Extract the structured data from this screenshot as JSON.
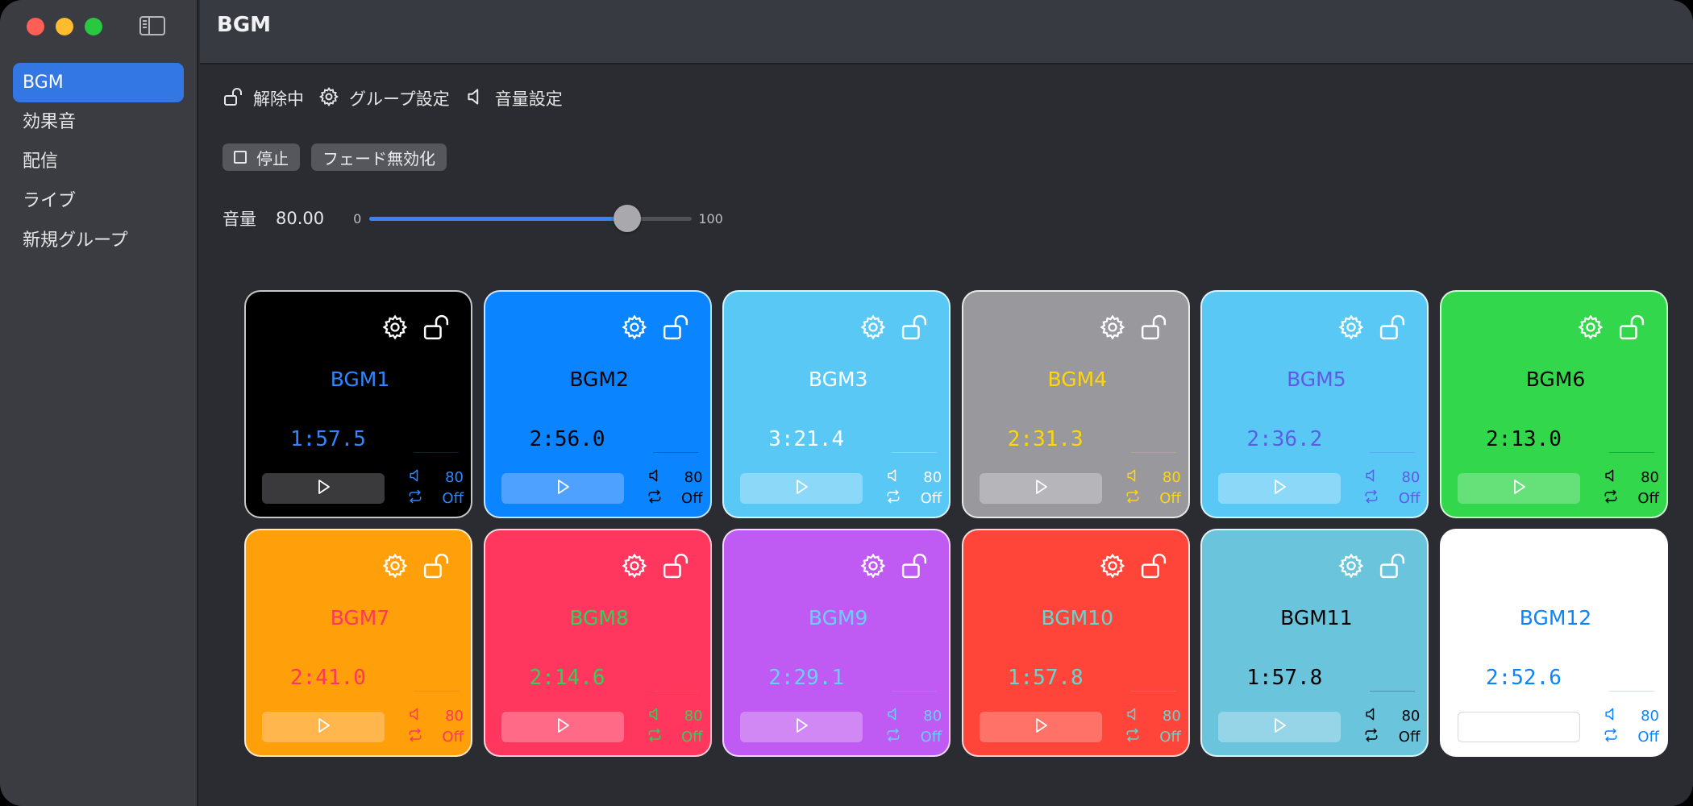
{
  "window": {
    "title": "BGM"
  },
  "sidebar": {
    "items": [
      {
        "label": "BGM",
        "active": true
      },
      {
        "label": "効果音"
      },
      {
        "label": "配信"
      },
      {
        "label": "ライブ"
      },
      {
        "label": "新規グループ"
      }
    ]
  },
  "toolbar": {
    "lock_label": "解除中",
    "group_settings_label": "グループ設定",
    "volume_settings_label": "音量設定"
  },
  "buttons": {
    "stop_label": "停止",
    "fade_label": "フェード無効化"
  },
  "volume": {
    "label": "音量",
    "value": "80.00",
    "min": "0",
    "max": "100",
    "level": 0.8,
    "accent": "#3a82f7"
  },
  "cards": [
    {
      "name": "BGM1",
      "time": "1:57.5",
      "volume": "80",
      "loop": "Off",
      "bg": "#000000",
      "fg": "#2f86ff",
      "btn": "#3a3a3c",
      "icon": "#ffffff"
    },
    {
      "name": "BGM2",
      "time": "2:56.0",
      "volume": "80",
      "loop": "Off",
      "bg": "#0a84ff",
      "fg": "#000000",
      "btn": "#4ea1ff",
      "icon": "#ffffff"
    },
    {
      "name": "BGM3",
      "time": "3:21.4",
      "volume": "80",
      "loop": "Off",
      "bg": "#5ac8f5",
      "fg": "#ffffff",
      "btn": "#8bd8f8",
      "icon": "#ffffff"
    },
    {
      "name": "BGM4",
      "time": "2:31.3",
      "volume": "80",
      "loop": "Off",
      "bg": "#98989d",
      "fg": "#ffd60a",
      "btn": "#b6b6ba",
      "icon": "#ffffff"
    },
    {
      "name": "BGM5",
      "time": "2:36.2",
      "volume": "80",
      "loop": "Off",
      "bg": "#5ac8f5",
      "fg": "#5e5ce6",
      "btn": "#8bd8f8",
      "icon": "#ffffff"
    },
    {
      "name": "BGM6",
      "time": "2:13.0",
      "volume": "80",
      "loop": "Off",
      "bg": "#32d74b",
      "fg": "#000000",
      "btn": "#66e079",
      "icon": "#ffffff"
    },
    {
      "name": "BGM7",
      "time": "2:41.0",
      "volume": "80",
      "loop": "Off",
      "bg": "#ff9f0a",
      "fg": "#ff375f",
      "btn": "#ffb74d",
      "icon": "#ffffff"
    },
    {
      "name": "BGM8",
      "time": "2:14.6",
      "volume": "80",
      "loop": "Off",
      "bg": "#ff375f",
      "fg": "#30d158",
      "btn": "#ff6a86",
      "icon": "#ffffff"
    },
    {
      "name": "BGM9",
      "time": "2:29.1",
      "volume": "80",
      "loop": "Off",
      "bg": "#bf5af2",
      "fg": "#64d2ff",
      "btn": "#d188f5",
      "icon": "#ffffff"
    },
    {
      "name": "BGM10",
      "time": "1:57.8",
      "volume": "80",
      "loop": "Off",
      "bg": "#ff453a",
      "fg": "#66d4cf",
      "btn": "#ff7268",
      "icon": "#ffffff"
    },
    {
      "name": "BGM11",
      "time": "1:57.8",
      "volume": "80",
      "loop": "Off",
      "bg": "#6ac4dc",
      "fg": "#000000",
      "btn": "#95d5e7",
      "icon": "#ffffff"
    },
    {
      "name": "BGM12",
      "time": "2:52.6",
      "volume": "80",
      "loop": "Off",
      "bg": "#ffffff",
      "fg": "#0a84ff",
      "btn": "#ffffff",
      "icon": "#ffffff"
    }
  ]
}
